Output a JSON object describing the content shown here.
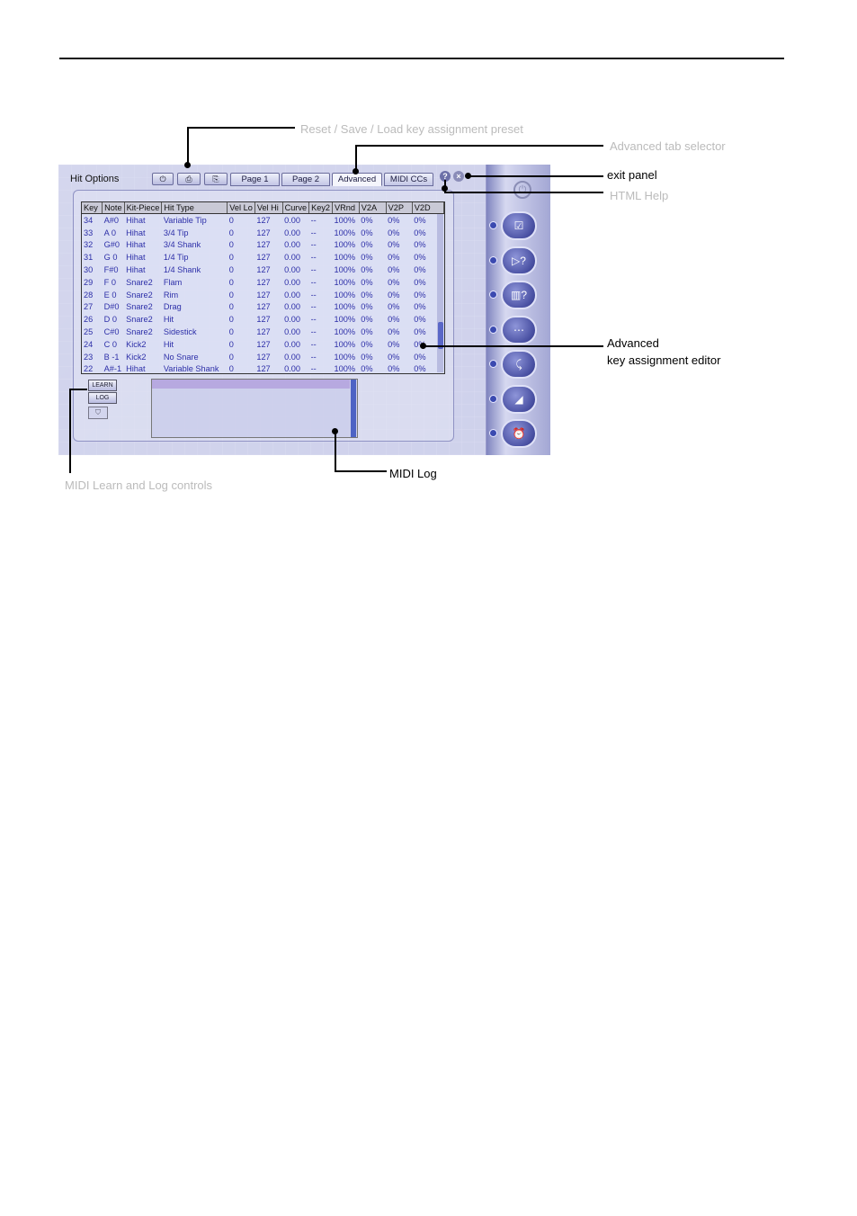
{
  "screenshot": {
    "title": "Hit Options",
    "toolbar": {
      "reset_icon": "power-icon",
      "save_label": "—",
      "load_label": "—"
    },
    "tabs": [
      {
        "label": "Page 1",
        "active": false
      },
      {
        "label": "Page 2",
        "active": false
      },
      {
        "label": "Advanced",
        "active": true
      },
      {
        "label": "MIDI CCs",
        "active": false
      }
    ],
    "help_label": "?",
    "close_label": "×",
    "table": {
      "columns": [
        "Key",
        "Note",
        "Kit-Piece",
        "Hit Type",
        "Vel Lo",
        "Vel Hi",
        "Curve",
        "Key2",
        "VRnd",
        "V2A",
        "V2P",
        "V2D"
      ],
      "rows": [
        [
          "34",
          "A#0",
          "Hihat",
          "Variable Tip",
          "0",
          "127",
          "0.00",
          "--",
          "100%",
          "0%",
          "0%",
          "0%"
        ],
        [
          "33",
          "A 0",
          "Hihat",
          "3/4 Tip",
          "0",
          "127",
          "0.00",
          "--",
          "100%",
          "0%",
          "0%",
          "0%"
        ],
        [
          "32",
          "G#0",
          "Hihat",
          "3/4 Shank",
          "0",
          "127",
          "0.00",
          "--",
          "100%",
          "0%",
          "0%",
          "0%"
        ],
        [
          "31",
          "G 0",
          "Hihat",
          "1/4 Tip",
          "0",
          "127",
          "0.00",
          "--",
          "100%",
          "0%",
          "0%",
          "0%"
        ],
        [
          "30",
          "F#0",
          "Hihat",
          "1/4 Shank",
          "0",
          "127",
          "0.00",
          "--",
          "100%",
          "0%",
          "0%",
          "0%"
        ],
        [
          "29",
          "F 0",
          "Snare2",
          "Flam",
          "0",
          "127",
          "0.00",
          "--",
          "100%",
          "0%",
          "0%",
          "0%"
        ],
        [
          "28",
          "E 0",
          "Snare2",
          "Rim",
          "0",
          "127",
          "0.00",
          "--",
          "100%",
          "0%",
          "0%",
          "0%"
        ],
        [
          "27",
          "D#0",
          "Snare2",
          "Drag",
          "0",
          "127",
          "0.00",
          "--",
          "100%",
          "0%",
          "0%",
          "0%"
        ],
        [
          "26",
          "D 0",
          "Snare2",
          "Hit",
          "0",
          "127",
          "0.00",
          "--",
          "100%",
          "0%",
          "0%",
          "0%"
        ],
        [
          "25",
          "C#0",
          "Snare2",
          "Sidestick",
          "0",
          "127",
          "0.00",
          "--",
          "100%",
          "0%",
          "0%",
          "0%"
        ],
        [
          "24",
          "C 0",
          "Kick2",
          "Hit",
          "0",
          "127",
          "0.00",
          "--",
          "100%",
          "0%",
          "0%",
          "0%"
        ],
        [
          "23",
          "B -1",
          "Kick2",
          "No Snare",
          "0",
          "127",
          "0.00",
          "--",
          "100%",
          "0%",
          "0%",
          "0%"
        ],
        [
          "22",
          "A#-1",
          "Hihat",
          "Variable Shank",
          "0",
          "127",
          "0.00",
          "--",
          "100%",
          "0%",
          "0%",
          "0%"
        ]
      ]
    },
    "learn_label": "LEARN",
    "log_label": "LOG",
    "dock": {
      "buttons": [
        "☑",
        "▷?",
        "▥?",
        "⋯",
        "⤹",
        "◢",
        "⏰"
      ]
    }
  },
  "callouts": {
    "preset": "Reset / Save / Load key assignment preset",
    "advanced_tab": "Advanced tab selector",
    "exit_panel": "exit panel",
    "html_help": "HTML Help",
    "editor_line1": "Advanced",
    "editor_line2": "key assignment editor",
    "learn_log": "MIDI Learn and Log controls",
    "midi_log": "MIDI Log"
  }
}
